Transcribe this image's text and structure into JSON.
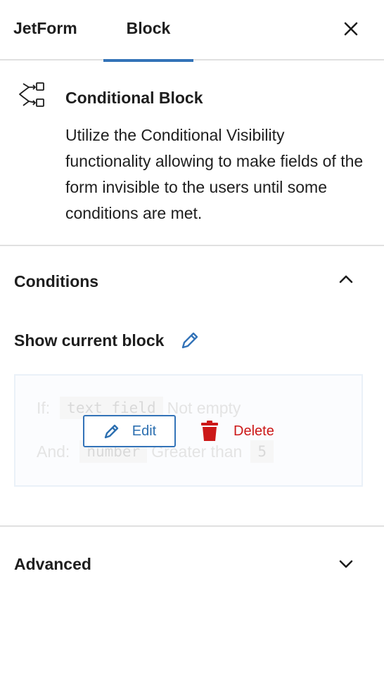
{
  "tabs": {
    "jetform": "JetForm",
    "block": "Block"
  },
  "block_card": {
    "title": "Conditional Block",
    "description": "Utilize the Conditional Visibility functionality allowing to make fields of the form invisible to the users until some conditions are met.",
    "icon": "conditional-block-icon"
  },
  "conditions_panel": {
    "title": "Conditions",
    "expanded": true,
    "show_label": "Show current block",
    "rules": [
      {
        "prefix": "If:",
        "field": "text_field",
        "operator": "Not empty",
        "value": ""
      },
      {
        "prefix": "And:",
        "field": "number",
        "operator": "Greater than",
        "value": "5"
      }
    ],
    "edit_label": "Edit",
    "delete_label": "Delete"
  },
  "advanced_panel": {
    "title": "Advanced",
    "expanded": false
  },
  "colors": {
    "accent": "#3373b8",
    "danger": "#cc1818",
    "border": "#e0e0e0"
  }
}
